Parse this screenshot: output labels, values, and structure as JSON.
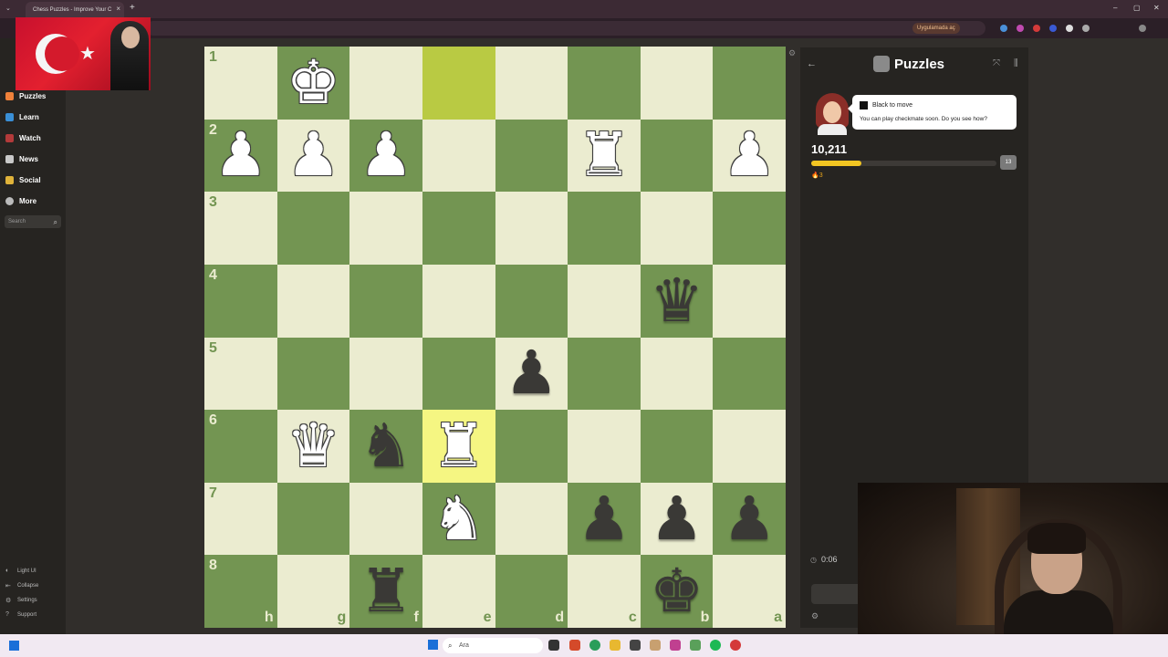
{
  "browser": {
    "tab_title": "Chess Puzzles - Improve Your C",
    "tab_close": "×",
    "new_tab": "+",
    "open_in_app": "Uygulamada aç"
  },
  "sidebar": {
    "items": [
      {
        "label": "Puzzles",
        "color": "#f0813a"
      },
      {
        "label": "Learn",
        "color": "#3a8fd6"
      },
      {
        "label": "Watch",
        "color": "#b33a3a"
      },
      {
        "label": "News",
        "color": "#c9c9c9"
      },
      {
        "label": "Social",
        "color": "#e0b33a"
      },
      {
        "label": "More",
        "color": "#bbbbbb"
      }
    ],
    "search_placeholder": "Search",
    "bottom": [
      "Light UI",
      "Collapse",
      "Settings",
      "Support"
    ]
  },
  "board": {
    "ranks": [
      "1",
      "2",
      "3",
      "4",
      "5",
      "6",
      "7",
      "8"
    ],
    "files": [
      "h",
      "g",
      "f",
      "e",
      "d",
      "c",
      "b",
      "a"
    ],
    "colors": {
      "light": "#ebecd0",
      "dark": "#739552",
      "highlight_light": "#f5f682",
      "highlight_dark": "#b9ca43"
    },
    "highlights": [
      [
        0,
        3
      ],
      [
        5,
        3
      ]
    ],
    "pieces": [
      {
        "row": 0,
        "col": 1,
        "glyph": "♚",
        "side": "w",
        "name": "white-king"
      },
      {
        "row": 1,
        "col": 0,
        "glyph": "♟",
        "side": "w",
        "name": "white-pawn"
      },
      {
        "row": 1,
        "col": 1,
        "glyph": "♟",
        "side": "w",
        "name": "white-pawn"
      },
      {
        "row": 1,
        "col": 2,
        "glyph": "♟",
        "side": "w",
        "name": "white-pawn"
      },
      {
        "row": 1,
        "col": 5,
        "glyph": "♜",
        "side": "w",
        "name": "white-rook"
      },
      {
        "row": 1,
        "col": 7,
        "glyph": "♟",
        "side": "w",
        "name": "white-pawn"
      },
      {
        "row": 3,
        "col": 6,
        "glyph": "♛",
        "side": "b",
        "name": "black-queen"
      },
      {
        "row": 4,
        "col": 4,
        "glyph": "♟",
        "side": "b",
        "name": "black-pawn"
      },
      {
        "row": 5,
        "col": 1,
        "glyph": "♛",
        "side": "w",
        "name": "white-queen"
      },
      {
        "row": 5,
        "col": 2,
        "glyph": "♞",
        "side": "b",
        "name": "black-knight"
      },
      {
        "row": 5,
        "col": 3,
        "glyph": "♜",
        "side": "w",
        "name": "white-rook"
      },
      {
        "row": 6,
        "col": 3,
        "glyph": "♞",
        "side": "w",
        "name": "white-knight"
      },
      {
        "row": 6,
        "col": 5,
        "glyph": "♟",
        "side": "b",
        "name": "black-pawn"
      },
      {
        "row": 6,
        "col": 6,
        "glyph": "♟",
        "side": "b",
        "name": "black-pawn"
      },
      {
        "row": 6,
        "col": 7,
        "glyph": "♟",
        "side": "b",
        "name": "black-pawn"
      },
      {
        "row": 7,
        "col": 2,
        "glyph": "♜",
        "side": "b",
        "name": "black-rook"
      },
      {
        "row": 7,
        "col": 6,
        "glyph": "♚",
        "side": "b",
        "name": "black-king"
      }
    ]
  },
  "panel": {
    "title": "Puzzles",
    "to_move": "Black to move",
    "hint": "You can play checkmate soon. Do you see how?",
    "rating": "10,211",
    "progress": 0.27,
    "next_badge": "13",
    "streak": "3",
    "timer": "0:06"
  },
  "taskbar": {
    "search_placeholder": "Ara"
  }
}
